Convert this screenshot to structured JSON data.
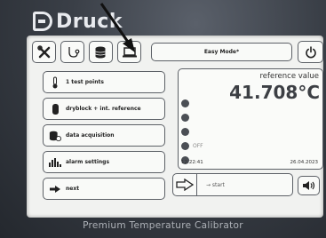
{
  "brand": {
    "logo_text": "Druck",
    "footer_text": "Premium Temperature Calibrator"
  },
  "toolbar": {
    "icons": [
      "tools-icon",
      "calibration-icon",
      "database-icon",
      "laptop-icon"
    ],
    "mode_label": "Easy Mode*",
    "power_icon": "power-icon"
  },
  "menu": {
    "items": [
      {
        "label": "1 test points",
        "icon": "thermometer-icon"
      },
      {
        "label": "dryblock + int. reference",
        "icon": "dryblock-icon"
      },
      {
        "label": "data acquisition",
        "icon": "data-acquisition-icon"
      },
      {
        "label": "alarm settings",
        "icon": "alarm-icon"
      },
      {
        "label": "next",
        "icon": "arrow-right-icon"
      }
    ]
  },
  "reference": {
    "label": "reference value",
    "value": "41.708°C",
    "status_off": "OFF",
    "time": "12:22:41",
    "date": "26.04.2023"
  },
  "actions": {
    "start_label": "→ start",
    "sound_icon": "speaker-icon"
  },
  "colors": {
    "screen_bg": "#f1f2f0",
    "bezel": "#3a3f47",
    "annotation_arrow": "#111111"
  }
}
